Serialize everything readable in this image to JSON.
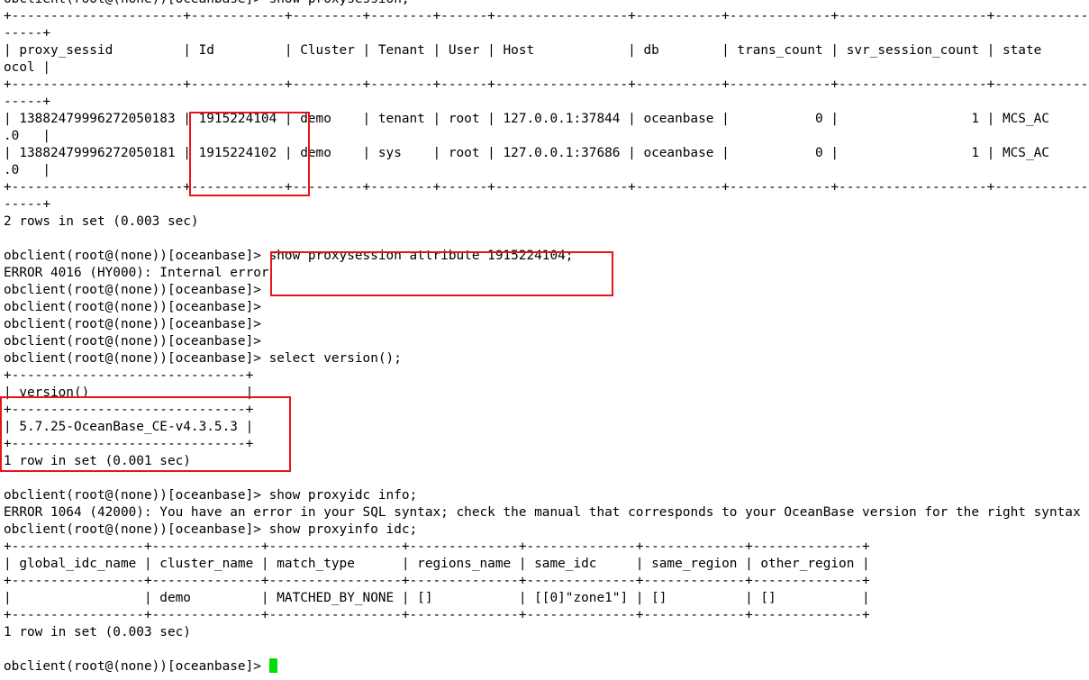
{
  "terminal": {
    "lines": [
      "obclient(root@(none))[oceanbase]> show proxysession;",
      "+----------------------+------------+---------+--------+------+-----------------+-----------+-------------+-------------------+--------------",
      "-----+",
      "| proxy_sessid         | Id         | Cluster | Tenant | User | Host            | db        | trans_count | svr_session_count | state",
      "ocol |",
      "+----------------------+------------+---------+--------+------+-----------------+-----------+-------------+-------------------+--------------",
      "-----+",
      "| 13882479996272050183 | 1915224104 | demo    | tenant | root | 127.0.0.1:37844 | oceanbase |           0 |                 1 | MCS_AC",
      ".0   |",
      "| 13882479996272050181 | 1915224102 | demo    | sys    | root | 127.0.0.1:37686 | oceanbase |           0 |                 1 | MCS_AC",
      ".0   |",
      "+----------------------+------------+---------+--------+------+-----------------+-----------+-------------+-------------------+--------------",
      "-----+",
      "2 rows in set (0.003 sec)",
      "",
      "obclient(root@(none))[oceanbase]> show proxysession attribute 1915224104;",
      "ERROR 4016 (HY000): Internal error",
      "obclient(root@(none))[oceanbase]>",
      "obclient(root@(none))[oceanbase]>",
      "obclient(root@(none))[oceanbase]>",
      "obclient(root@(none))[oceanbase]>",
      "obclient(root@(none))[oceanbase]> select version();",
      "+------------------------------+",
      "| version()                    |",
      "+------------------------------+",
      "| 5.7.25-OceanBase_CE-v4.3.5.3 |",
      "+------------------------------+",
      "1 row in set (0.001 sec)",
      "",
      "obclient(root@(none))[oceanbase]> show proxyidc info;",
      "ERROR 1064 (42000): You have an error in your SQL syntax; check the manual that corresponds to your OceanBase version for the right syntax",
      "obclient(root@(none))[oceanbase]> show proxyinfo idc;",
      "+-----------------+--------------+-----------------+--------------+--------------+-------------+--------------+",
      "| global_idc_name | cluster_name | match_type      | regions_name | same_idc     | same_region | other_region |",
      "+-----------------+--------------+-----------------+--------------+--------------+-------------+--------------+",
      "|                 | demo         | MATCHED_BY_NONE | []           | [[0]\"zone1\"] | []          | []           |",
      "+-----------------+--------------+-----------------+--------------+--------------+-------------+--------------+",
      "1 row in set (0.003 sec)",
      "",
      "obclient(root@(none))[oceanbase]> "
    ]
  },
  "colors": {
    "background": "#ffffff",
    "text": "#000000",
    "cursor": "#00dd00",
    "highlight_box": "#e8141c"
  }
}
